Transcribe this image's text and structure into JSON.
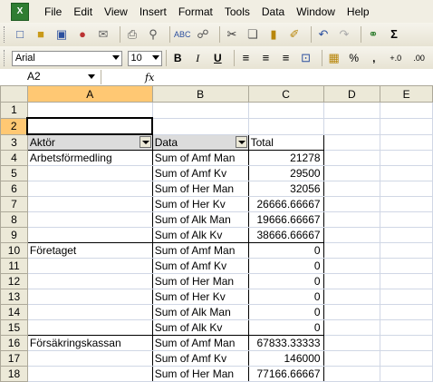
{
  "menus": [
    "File",
    "Edit",
    "View",
    "Insert",
    "Format",
    "Tools",
    "Data",
    "Window",
    "Help"
  ],
  "app_icon_label": "X",
  "toolbar": {
    "font_name": "Arial",
    "font_size": "10",
    "bold": "B",
    "italic": "I",
    "underline": "U",
    "percent": "%",
    "comma": ",",
    "inc_decimal": "+.0",
    "dec_decimal": ".00"
  },
  "formula": {
    "name_box": "A2",
    "fx": "fx",
    "content": ""
  },
  "columns": [
    "A",
    "B",
    "C",
    "D",
    "E"
  ],
  "rows": [
    {
      "n": "1",
      "a": "",
      "b": "",
      "c": ""
    },
    {
      "n": "2",
      "a": "",
      "b": "",
      "c": ""
    },
    {
      "n": "3",
      "a": "Aktör",
      "b": "Data",
      "c": "Total"
    },
    {
      "n": "4",
      "a": "Arbetsförmedling",
      "b": "Sum of Amf Man",
      "c": "21278"
    },
    {
      "n": "5",
      "a": "",
      "b": "Sum of Amf Kv",
      "c": "29500"
    },
    {
      "n": "6",
      "a": "",
      "b": "Sum of Her Man",
      "c": "32056"
    },
    {
      "n": "7",
      "a": "",
      "b": "Sum of Her Kv",
      "c": "26666.66667"
    },
    {
      "n": "8",
      "a": "",
      "b": "Sum of Alk Man",
      "c": "19666.66667"
    },
    {
      "n": "9",
      "a": "",
      "b": "Sum of Alk Kv",
      "c": "38666.66667"
    },
    {
      "n": "10",
      "a": "Företaget",
      "b": "Sum of Amf Man",
      "c": "0"
    },
    {
      "n": "11",
      "a": "",
      "b": "Sum of Amf Kv",
      "c": "0"
    },
    {
      "n": "12",
      "a": "",
      "b": "Sum of Her Man",
      "c": "0"
    },
    {
      "n": "13",
      "a": "",
      "b": "Sum of Her Kv",
      "c": "0"
    },
    {
      "n": "14",
      "a": "",
      "b": "Sum of Alk Man",
      "c": "0"
    },
    {
      "n": "15",
      "a": "",
      "b": "Sum of Alk Kv",
      "c": "0"
    },
    {
      "n": "16",
      "a": "Försäkringskassan",
      "b": "Sum of Amf Man",
      "c": "67833.33333"
    },
    {
      "n": "17",
      "a": "",
      "b": "Sum of Amf Kv",
      "c": "146000"
    },
    {
      "n": "18",
      "a": "",
      "b": "Sum of Her Man",
      "c": "77166.66667"
    }
  ]
}
